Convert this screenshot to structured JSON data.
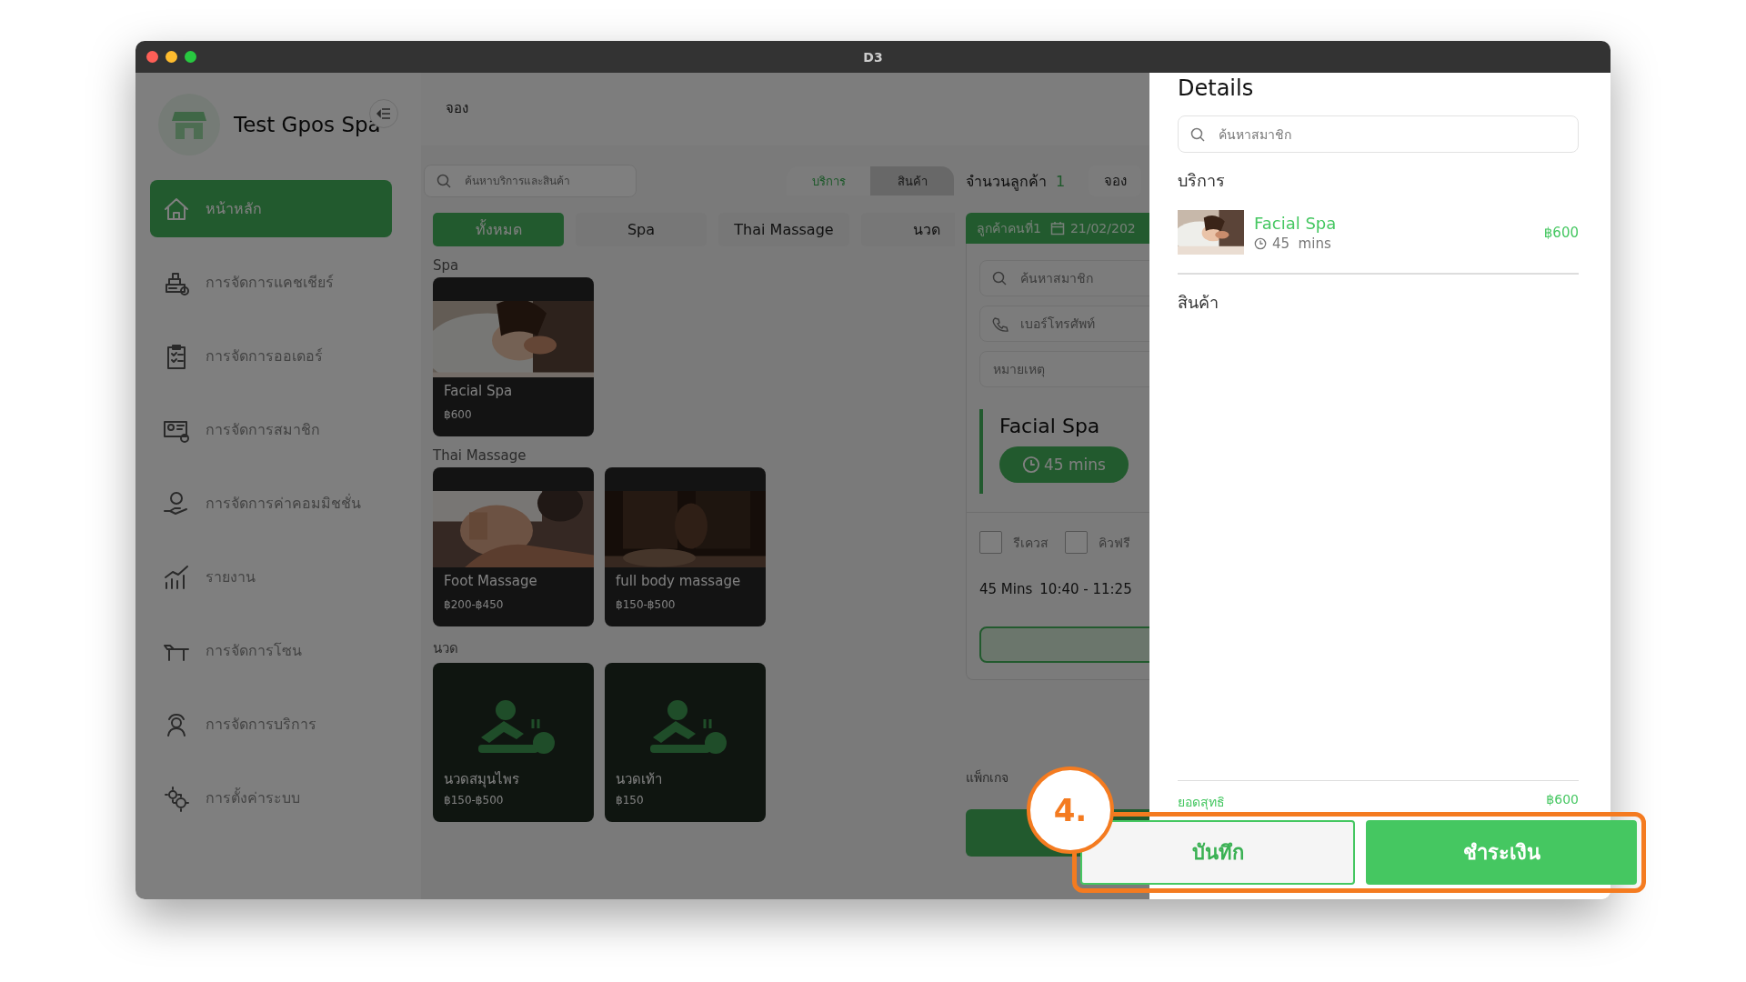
{
  "window": {
    "title": "D3"
  },
  "sidebar": {
    "brand": "Test Gpos Spa",
    "items": [
      {
        "label": "หน้าหลัก",
        "kind": "home",
        "selected": true
      },
      {
        "label": "การจัดการแคชเชียร์",
        "kind": "cashier",
        "selected": false
      },
      {
        "label": "การจัดการออเดอร์",
        "kind": "orders",
        "selected": false
      },
      {
        "label": "การจัดการสมาชิก",
        "kind": "members",
        "selected": false
      },
      {
        "label": "การจัดการค่าคอมมิชชั่น",
        "kind": "commission",
        "selected": false
      },
      {
        "label": "รายงาน",
        "kind": "reports",
        "selected": false
      },
      {
        "label": "การจัดการโซน",
        "kind": "zones",
        "selected": false
      },
      {
        "label": "การจัดการบริการ",
        "kind": "services",
        "selected": false
      },
      {
        "label": "การตั้งค่าระบบ",
        "kind": "settings",
        "selected": false
      }
    ]
  },
  "main": {
    "title": "จอง",
    "search": {
      "placeholder": "ค้นหาบริการและสินค้า"
    },
    "mode_tabs": [
      {
        "label": "บริการ",
        "selected": true
      },
      {
        "label": "สินค้า",
        "selected": false
      }
    ],
    "categories": [
      {
        "label": "ทั้งหมด",
        "selected": true
      },
      {
        "label": "Spa",
        "selected": false
      },
      {
        "label": "Thai Massage",
        "selected": false
      },
      {
        "label": "นวด",
        "selected": false
      }
    ],
    "sections": [
      {
        "title": "Spa",
        "items": [
          {
            "name": "Facial Spa",
            "price": "฿600"
          }
        ]
      },
      {
        "title": "Thai Massage",
        "items": [
          {
            "name": "Foot Massage",
            "price": "฿200-฿450"
          },
          {
            "name": "full body massage",
            "price": "฿150-฿500"
          }
        ]
      },
      {
        "title": "นวด",
        "items": [
          {
            "name": "นวดสมุนไพร",
            "price": "฿150-฿500",
            "kind": "placeholder"
          },
          {
            "name": "นวดเท้า",
            "price": "฿150",
            "kind": "placeholder"
          }
        ]
      }
    ]
  },
  "customer": {
    "count_label": "จำนวนลูกค้า",
    "count": "1",
    "book_button": "จอง",
    "guest_label": "ลูกค้าคนที่1",
    "date": "21/02/202",
    "fields": [
      {
        "placeholder": "ค้นหาสมาชิก",
        "kind": "search"
      },
      {
        "placeholder": "เบอร์โทรศัพท์",
        "kind": "phone"
      },
      {
        "placeholder": "หมายเหตุ",
        "kind": "plain"
      }
    ],
    "service": {
      "name": "Facial Spa",
      "duration": "45 mins"
    },
    "options": [
      {
        "label": "รีเควส",
        "checked": false
      },
      {
        "label": "คิวฟรี",
        "checked": false
      }
    ],
    "duration": "45 Mins",
    "time_range": "10:40 - 11:25",
    "package_label": "แพ็กเกจ"
  },
  "details": {
    "title": "Details",
    "search": {
      "placeholder": "ค้นหาสมาชิก"
    },
    "services_label": "บริการ",
    "services": [
      {
        "name": "Facial Spa",
        "duration": "45  mins",
        "price": "฿600"
      }
    ],
    "products_label": "สินค้า",
    "total_label": "ยอดสุทธิ",
    "total": "฿600"
  },
  "callout": {
    "step": "4.",
    "buttons": [
      {
        "label": "บันทึก",
        "kind": "secondary"
      },
      {
        "label": "ชำระเงิน",
        "kind": "primary"
      }
    ]
  }
}
